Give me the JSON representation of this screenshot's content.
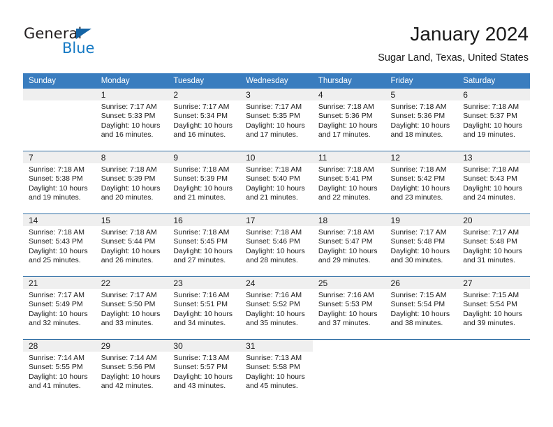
{
  "brand": {
    "name_primary": "General",
    "name_secondary": "Blue"
  },
  "header": {
    "title": "January 2024",
    "subtitle": "Sugar Land, Texas, United States"
  },
  "colors": {
    "header_blue": "#3a7dbf",
    "row_divider": "#2e6da4",
    "date_band": "#efefef",
    "logo_blue": "#1479c4",
    "logo_dark": "#231f20"
  },
  "weekdays": [
    "Sunday",
    "Monday",
    "Tuesday",
    "Wednesday",
    "Thursday",
    "Friday",
    "Saturday"
  ],
  "labels": {
    "sunrise_prefix": "Sunrise:",
    "sunset_prefix": "Sunset:",
    "daylight_prefix": "Daylight:"
  },
  "weeks": [
    [
      {
        "day": "",
        "empty": true
      },
      {
        "day": "1",
        "sunrise": "Sunrise: 7:17 AM",
        "sunset": "Sunset: 5:33 PM",
        "daylight1": "Daylight: 10 hours",
        "daylight2": "and 16 minutes."
      },
      {
        "day": "2",
        "sunrise": "Sunrise: 7:17 AM",
        "sunset": "Sunset: 5:34 PM",
        "daylight1": "Daylight: 10 hours",
        "daylight2": "and 16 minutes."
      },
      {
        "day": "3",
        "sunrise": "Sunrise: 7:17 AM",
        "sunset": "Sunset: 5:35 PM",
        "daylight1": "Daylight: 10 hours",
        "daylight2": "and 17 minutes."
      },
      {
        "day": "4",
        "sunrise": "Sunrise: 7:18 AM",
        "sunset": "Sunset: 5:36 PM",
        "daylight1": "Daylight: 10 hours",
        "daylight2": "and 17 minutes."
      },
      {
        "day": "5",
        "sunrise": "Sunrise: 7:18 AM",
        "sunset": "Sunset: 5:36 PM",
        "daylight1": "Daylight: 10 hours",
        "daylight2": "and 18 minutes."
      },
      {
        "day": "6",
        "sunrise": "Sunrise: 7:18 AM",
        "sunset": "Sunset: 5:37 PM",
        "daylight1": "Daylight: 10 hours",
        "daylight2": "and 19 minutes."
      }
    ],
    [
      {
        "day": "7",
        "sunrise": "Sunrise: 7:18 AM",
        "sunset": "Sunset: 5:38 PM",
        "daylight1": "Daylight: 10 hours",
        "daylight2": "and 19 minutes."
      },
      {
        "day": "8",
        "sunrise": "Sunrise: 7:18 AM",
        "sunset": "Sunset: 5:39 PM",
        "daylight1": "Daylight: 10 hours",
        "daylight2": "and 20 minutes."
      },
      {
        "day": "9",
        "sunrise": "Sunrise: 7:18 AM",
        "sunset": "Sunset: 5:39 PM",
        "daylight1": "Daylight: 10 hours",
        "daylight2": "and 21 minutes."
      },
      {
        "day": "10",
        "sunrise": "Sunrise: 7:18 AM",
        "sunset": "Sunset: 5:40 PM",
        "daylight1": "Daylight: 10 hours",
        "daylight2": "and 21 minutes."
      },
      {
        "day": "11",
        "sunrise": "Sunrise: 7:18 AM",
        "sunset": "Sunset: 5:41 PM",
        "daylight1": "Daylight: 10 hours",
        "daylight2": "and 22 minutes."
      },
      {
        "day": "12",
        "sunrise": "Sunrise: 7:18 AM",
        "sunset": "Sunset: 5:42 PM",
        "daylight1": "Daylight: 10 hours",
        "daylight2": "and 23 minutes."
      },
      {
        "day": "13",
        "sunrise": "Sunrise: 7:18 AM",
        "sunset": "Sunset: 5:43 PM",
        "daylight1": "Daylight: 10 hours",
        "daylight2": "and 24 minutes."
      }
    ],
    [
      {
        "day": "14",
        "sunrise": "Sunrise: 7:18 AM",
        "sunset": "Sunset: 5:43 PM",
        "daylight1": "Daylight: 10 hours",
        "daylight2": "and 25 minutes."
      },
      {
        "day": "15",
        "sunrise": "Sunrise: 7:18 AM",
        "sunset": "Sunset: 5:44 PM",
        "daylight1": "Daylight: 10 hours",
        "daylight2": "and 26 minutes."
      },
      {
        "day": "16",
        "sunrise": "Sunrise: 7:18 AM",
        "sunset": "Sunset: 5:45 PM",
        "daylight1": "Daylight: 10 hours",
        "daylight2": "and 27 minutes."
      },
      {
        "day": "17",
        "sunrise": "Sunrise: 7:18 AM",
        "sunset": "Sunset: 5:46 PM",
        "daylight1": "Daylight: 10 hours",
        "daylight2": "and 28 minutes."
      },
      {
        "day": "18",
        "sunrise": "Sunrise: 7:18 AM",
        "sunset": "Sunset: 5:47 PM",
        "daylight1": "Daylight: 10 hours",
        "daylight2": "and 29 minutes."
      },
      {
        "day": "19",
        "sunrise": "Sunrise: 7:17 AM",
        "sunset": "Sunset: 5:48 PM",
        "daylight1": "Daylight: 10 hours",
        "daylight2": "and 30 minutes."
      },
      {
        "day": "20",
        "sunrise": "Sunrise: 7:17 AM",
        "sunset": "Sunset: 5:48 PM",
        "daylight1": "Daylight: 10 hours",
        "daylight2": "and 31 minutes."
      }
    ],
    [
      {
        "day": "21",
        "sunrise": "Sunrise: 7:17 AM",
        "sunset": "Sunset: 5:49 PM",
        "daylight1": "Daylight: 10 hours",
        "daylight2": "and 32 minutes."
      },
      {
        "day": "22",
        "sunrise": "Sunrise: 7:17 AM",
        "sunset": "Sunset: 5:50 PM",
        "daylight1": "Daylight: 10 hours",
        "daylight2": "and 33 minutes."
      },
      {
        "day": "23",
        "sunrise": "Sunrise: 7:16 AM",
        "sunset": "Sunset: 5:51 PM",
        "daylight1": "Daylight: 10 hours",
        "daylight2": "and 34 minutes."
      },
      {
        "day": "24",
        "sunrise": "Sunrise: 7:16 AM",
        "sunset": "Sunset: 5:52 PM",
        "daylight1": "Daylight: 10 hours",
        "daylight2": "and 35 minutes."
      },
      {
        "day": "25",
        "sunrise": "Sunrise: 7:16 AM",
        "sunset": "Sunset: 5:53 PM",
        "daylight1": "Daylight: 10 hours",
        "daylight2": "and 37 minutes."
      },
      {
        "day": "26",
        "sunrise": "Sunrise: 7:15 AM",
        "sunset": "Sunset: 5:54 PM",
        "daylight1": "Daylight: 10 hours",
        "daylight2": "and 38 minutes."
      },
      {
        "day": "27",
        "sunrise": "Sunrise: 7:15 AM",
        "sunset": "Sunset: 5:54 PM",
        "daylight1": "Daylight: 10 hours",
        "daylight2": "and 39 minutes."
      }
    ],
    [
      {
        "day": "28",
        "sunrise": "Sunrise: 7:14 AM",
        "sunset": "Sunset: 5:55 PM",
        "daylight1": "Daylight: 10 hours",
        "daylight2": "and 41 minutes."
      },
      {
        "day": "29",
        "sunrise": "Sunrise: 7:14 AM",
        "sunset": "Sunset: 5:56 PM",
        "daylight1": "Daylight: 10 hours",
        "daylight2": "and 42 minutes."
      },
      {
        "day": "30",
        "sunrise": "Sunrise: 7:13 AM",
        "sunset": "Sunset: 5:57 PM",
        "daylight1": "Daylight: 10 hours",
        "daylight2": "and 43 minutes."
      },
      {
        "day": "31",
        "sunrise": "Sunrise: 7:13 AM",
        "sunset": "Sunset: 5:58 PM",
        "daylight1": "Daylight: 10 hours",
        "daylight2": "and 45 minutes."
      },
      {
        "day": "",
        "empty": true,
        "blank": true
      },
      {
        "day": "",
        "empty": true,
        "blank": true
      },
      {
        "day": "",
        "empty": true,
        "blank": true
      }
    ]
  ]
}
